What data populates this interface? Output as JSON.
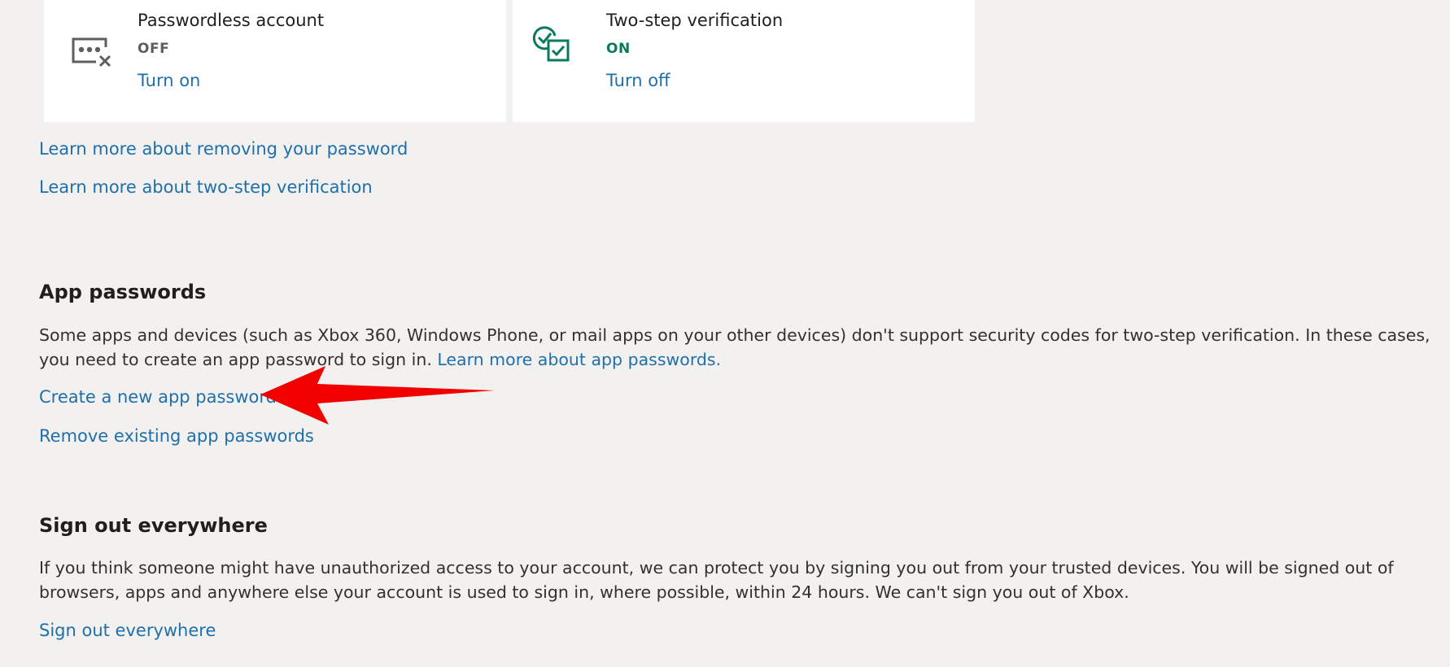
{
  "security": {
    "passwordless": {
      "title": "Passwordless account",
      "status": "OFF",
      "action": "Turn on",
      "icon": "passwordless-icon"
    },
    "two_step": {
      "title": "Two-step verification",
      "status": "ON",
      "action": "Turn off",
      "icon": "verification-check-icon"
    },
    "links": {
      "remove_password": "Learn more about removing your password",
      "two_step": "Learn more about two-step verification"
    }
  },
  "app_passwords": {
    "heading": "App passwords",
    "description": "Some apps and devices (such as Xbox 360, Windows Phone, or mail apps on your other devices) don't support security codes for two-step verification. In these cases, you need to create an app password to sign in.",
    "learn_more": "Learn more about app passwords.",
    "create_link": "Create a new app password",
    "remove_link": "Remove existing app passwords"
  },
  "sign_out": {
    "heading": "Sign out everywhere",
    "description": "If you think someone might have unauthorized access to your account, we can protect you by signing you out from your trusted devices. You will be signed out of browsers, apps and anywhere else your account is used to sign in, where possible, within 24 hours. We can't sign you out of Xbox.",
    "link": "Sign out everywhere"
  },
  "colors": {
    "link": "#1f6fab",
    "status_on": "#0b7a5a",
    "status_off": "#605e5c",
    "annotation_arrow": "#f20000",
    "background": "#f2f1f0"
  }
}
